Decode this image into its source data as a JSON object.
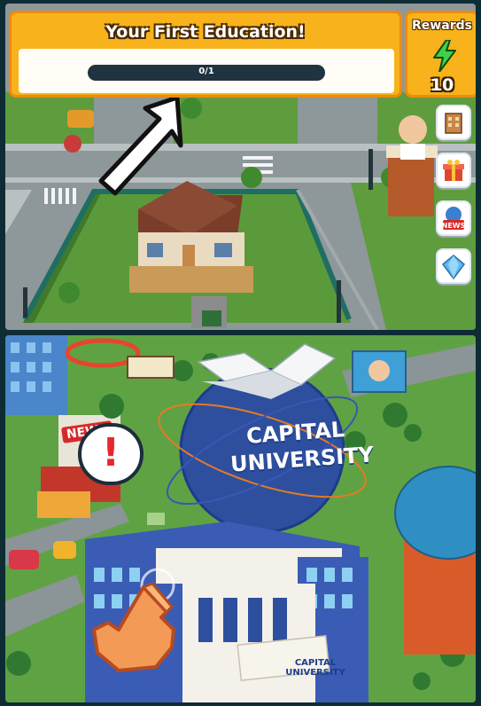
{
  "quest": {
    "title": "Your First Education!",
    "progress_text": "0/1",
    "progress_fraction": 0.0
  },
  "rewards": {
    "label": "Rewards",
    "count": "10",
    "icon": "lightning-bolt-icon"
  },
  "side_menu": [
    {
      "name": "building-icon"
    },
    {
      "name": "gift-icon"
    },
    {
      "name": "news-icon",
      "label": "NEWS"
    },
    {
      "name": "diamond-icon"
    }
  ],
  "scene_top": {
    "arrow_icon": "pointer-arrow-icon"
  },
  "scene_bottom": {
    "globe_line1": "CAPITAL",
    "globe_line2": "UNIVERSITY",
    "sign_line1": "CAPITAL",
    "sign_line2": "UNIVERSITY",
    "news_sign": "NEWS",
    "alert_mark": "!"
  },
  "colors": {
    "banner_orange": "#f7b21c",
    "banner_border": "#f08a0b",
    "bolt_green": "#3fd14b",
    "globe_blue": "#2e4f9e"
  }
}
